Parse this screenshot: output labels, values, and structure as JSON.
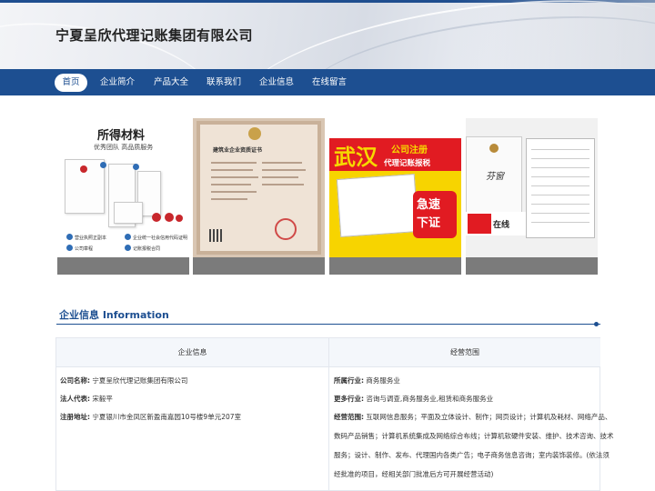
{
  "header": {
    "site_title": "宁夏呈欣代理记账集团有限公司"
  },
  "nav": {
    "items": [
      {
        "label": "首页",
        "active": true
      },
      {
        "label": "企业简介",
        "active": false
      },
      {
        "label": "产品大全",
        "active": false
      },
      {
        "label": "联系我们",
        "active": false
      },
      {
        "label": "企业信息",
        "active": false
      },
      {
        "label": "在线留言",
        "active": false
      }
    ]
  },
  "gallery": {
    "cards": [
      {
        "title": "所得材料",
        "subtitle": "优秀团队  高品质服务",
        "legend": [
          "营业执照正副本",
          "企业统一社会信用代码证明",
          "公司章程",
          "记账报税合同"
        ]
      },
      {
        "heading": "建筑业企业资质证书"
      },
      {
        "big": "武汉",
        "line1": "公司注册",
        "line2": "代理记账报税",
        "badge1": "急速",
        "badge2": "下证"
      },
      {
        "signature": "芬窗",
        "logo_text": "在线"
      }
    ]
  },
  "section": {
    "title": "企业信息 Information"
  },
  "info_table": {
    "headers": [
      "企业信息",
      "经营范围"
    ],
    "left": [
      {
        "label": "公司名称:",
        "value": "宁夏呈欣代理记账集团有限公司"
      },
      {
        "label": "法人代表:",
        "value": "宋毅平"
      },
      {
        "label": "注册地址:",
        "value": "宁夏银川市金凤区新盈南嘉园10号楼9单元207室"
      }
    ],
    "right": {
      "industry_label": "所属行业:",
      "industry": "商务服务业",
      "more_label": "更多行业:",
      "more": "咨询与调查,商务服务业,租赁和商务服务业",
      "scope_label": "经营范围:",
      "scope_lines": [
        "互联网信息服务；平面及立体设计、制作；网页设计；计算机及耗材、网络产品、",
        "数码产品销售；计算机系统集成及网络综合布线；计算机软硬件安装、维护、技术咨询、技术",
        "服务；设计、制作、发布、代理国内各类广告；电子商务信息咨询；室内装饰装修。(依法须",
        "经批准的项目，经相关部门批准后方可开展经营活动)"
      ]
    }
  },
  "colors": {
    "brand_blue": "#1d4f91",
    "caption_gray": "#7b7b7b"
  }
}
